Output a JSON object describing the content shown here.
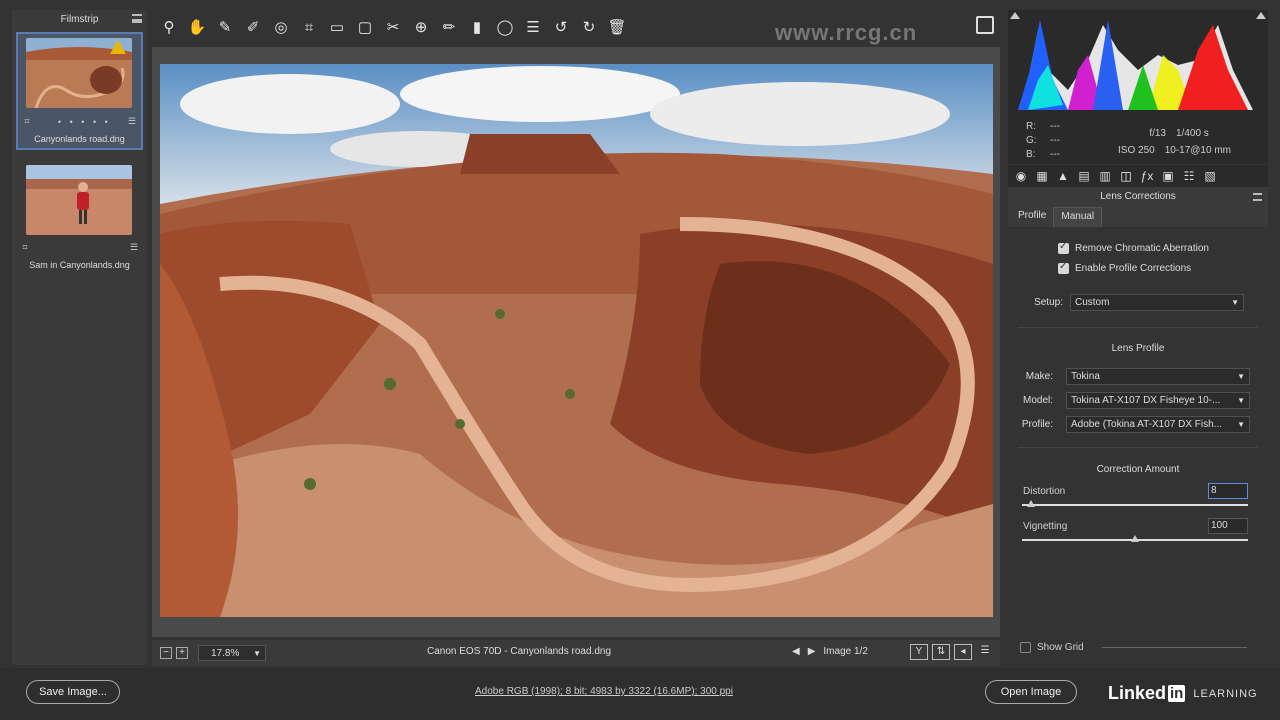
{
  "filmstrip": {
    "title": "Filmstrip",
    "items": [
      {
        "label": "Canyonlands road.dng",
        "dots": "• • • • •",
        "selected": true,
        "warning": true
      },
      {
        "label": "Sam in Canyonlands.dng",
        "dots": "",
        "selected": false,
        "warning": false
      }
    ]
  },
  "toolbar": {
    "tools": [
      "zoom-tool",
      "hand-tool",
      "white-balance-tool",
      "color-sampler-tool",
      "targeted-adjustment-tool",
      "crop-tool",
      "straighten-tool",
      "transform-tool",
      "spot-removal-tool",
      "red-eye-tool",
      "adjustment-brush",
      "graduated-filter",
      "radial-filter",
      "preferences",
      "rotate-ccw",
      "rotate-cw",
      "delete"
    ]
  },
  "watermark_top": "www.rrcg.cn",
  "preview": {
    "zoom_value": "17.8%",
    "caption": "Canon EOS 70D  -  Canyonlands road.dng",
    "image_counter": "Image 1/2"
  },
  "info": {
    "r_label": "R:",
    "r_value": "---",
    "g_label": "G:",
    "g_value": "---",
    "b_label": "B:",
    "b_value": "---",
    "aperture": "f/13",
    "shutter": "1/400 s",
    "iso": "ISO 250",
    "lens": "10-17@10 mm"
  },
  "panel": {
    "title": "Lens Corrections",
    "tabs": [
      "Profile",
      "Manual"
    ],
    "active_tab": "Profile",
    "remove_ca_label": "Remove Chromatic Aberration",
    "enable_profile_label": "Enable Profile Corrections",
    "setup_label": "Setup:",
    "setup_value": "Custom",
    "lens_profile_title": "Lens Profile",
    "make_label": "Make:",
    "make_value": "Tokina",
    "model_label": "Model:",
    "model_value": "Tokina AT-X107 DX Fisheye 10-...",
    "profile_label": "Profile:",
    "profile_value": "Adobe (Tokina AT-X107 DX Fish...",
    "correction_title": "Correction Amount",
    "distortion_label": "Distortion",
    "distortion_value": "8",
    "distortion_level": 0.04,
    "vignetting_label": "Vignetting",
    "vignetting_value": "100",
    "vignetting_level": 0.5,
    "show_grid_label": "Show Grid"
  },
  "footer": {
    "save_label": "Save Image...",
    "workflow_text": "Adobe RGB (1998); 8 bit; 4983 by 3322 (16.6MP); 300 ppi",
    "open_label": "Open Image",
    "brand_text": "Linked",
    "brand_in": "in",
    "brand_learning": "LEARNING"
  }
}
